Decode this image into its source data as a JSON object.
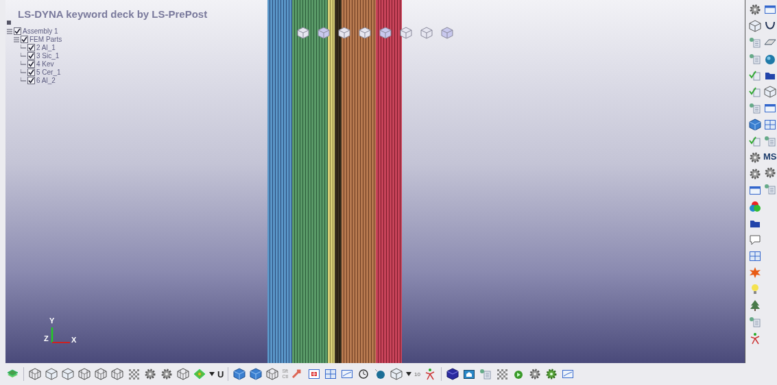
{
  "viewport": {
    "title": "LS-DYNA keyword deck by LS-PrePost",
    "tree": [
      {
        "label": "Assembly 1",
        "checked": true,
        "expanded": true,
        "children": [
          {
            "label": "FEM Parts",
            "checked": true,
            "expanded": true,
            "children": [
              {
                "label": "2 Al_1",
                "checked": true
              },
              {
                "label": "3 Sic_1",
                "checked": true
              },
              {
                "label": "4 Kev",
                "checked": true
              },
              {
                "label": "5 Cer_1",
                "checked": true
              },
              {
                "label": "6 Al_2",
                "checked": true
              }
            ]
          }
        ]
      }
    ],
    "axes": {
      "y": "Y",
      "z": "Z",
      "x": "X"
    }
  },
  "right_toolbar": {
    "label": "MS"
  },
  "bottom_toolbar": {
    "u_label": "U",
    "shift_label": "Sft\nCtl",
    "count_label": "10"
  }
}
